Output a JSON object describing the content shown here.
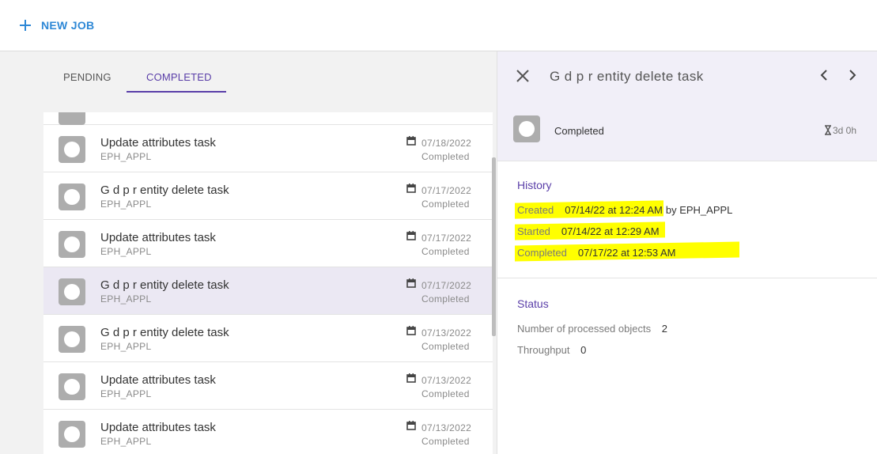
{
  "toolbar": {
    "new_job_label": "NEW JOB"
  },
  "tabs": [
    {
      "label": "PENDING",
      "active": false
    },
    {
      "label": "COMPLETED",
      "active": true
    }
  ],
  "jobs": [
    {
      "title": "Update attributes task",
      "owner": "EPH_APPL",
      "date": "07/18/2022",
      "status": "Completed",
      "selected": false
    },
    {
      "title": "G d p r entity delete task",
      "owner": "EPH_APPL",
      "date": "07/17/2022",
      "status": "Completed",
      "selected": false
    },
    {
      "title": "Update attributes task",
      "owner": "EPH_APPL",
      "date": "07/17/2022",
      "status": "Completed",
      "selected": false
    },
    {
      "title": "G d p r entity delete task",
      "owner": "EPH_APPL",
      "date": "07/17/2022",
      "status": "Completed",
      "selected": true
    },
    {
      "title": "G d p r entity delete task",
      "owner": "EPH_APPL",
      "date": "07/13/2022",
      "status": "Completed",
      "selected": false
    },
    {
      "title": "Update attributes task",
      "owner": "EPH_APPL",
      "date": "07/13/2022",
      "status": "Completed",
      "selected": false
    },
    {
      "title": "Update attributes task",
      "owner": "EPH_APPL",
      "date": "07/13/2022",
      "status": "Completed",
      "selected": false
    }
  ],
  "detail": {
    "title": "G d p r entity delete task",
    "status": "Completed",
    "duration": "3d 0h",
    "history": {
      "heading": "History",
      "created_label": "Created",
      "created_value": "07/14/22 at 12:24 AM",
      "created_by": "by EPH_APPL",
      "started_label": "Started",
      "started_value": "07/14/22 at 12:29 AM",
      "completed_label": "Completed",
      "completed_value": "07/17/22 at 12:53 AM"
    },
    "status_section": {
      "heading": "Status",
      "processed_label": "Number of processed objects",
      "processed_value": "2",
      "throughput_label": "Throughput",
      "throughput_value": "0"
    }
  },
  "colors": {
    "accent": "#5a3ea8",
    "link": "#2e88d6",
    "highlight": "#ffff00",
    "selected_row": "#ebe8f3"
  },
  "icons": [
    "plus-icon",
    "calendar-icon",
    "close-icon",
    "chevron-left-icon",
    "chevron-right-icon",
    "hourglass-icon"
  ]
}
